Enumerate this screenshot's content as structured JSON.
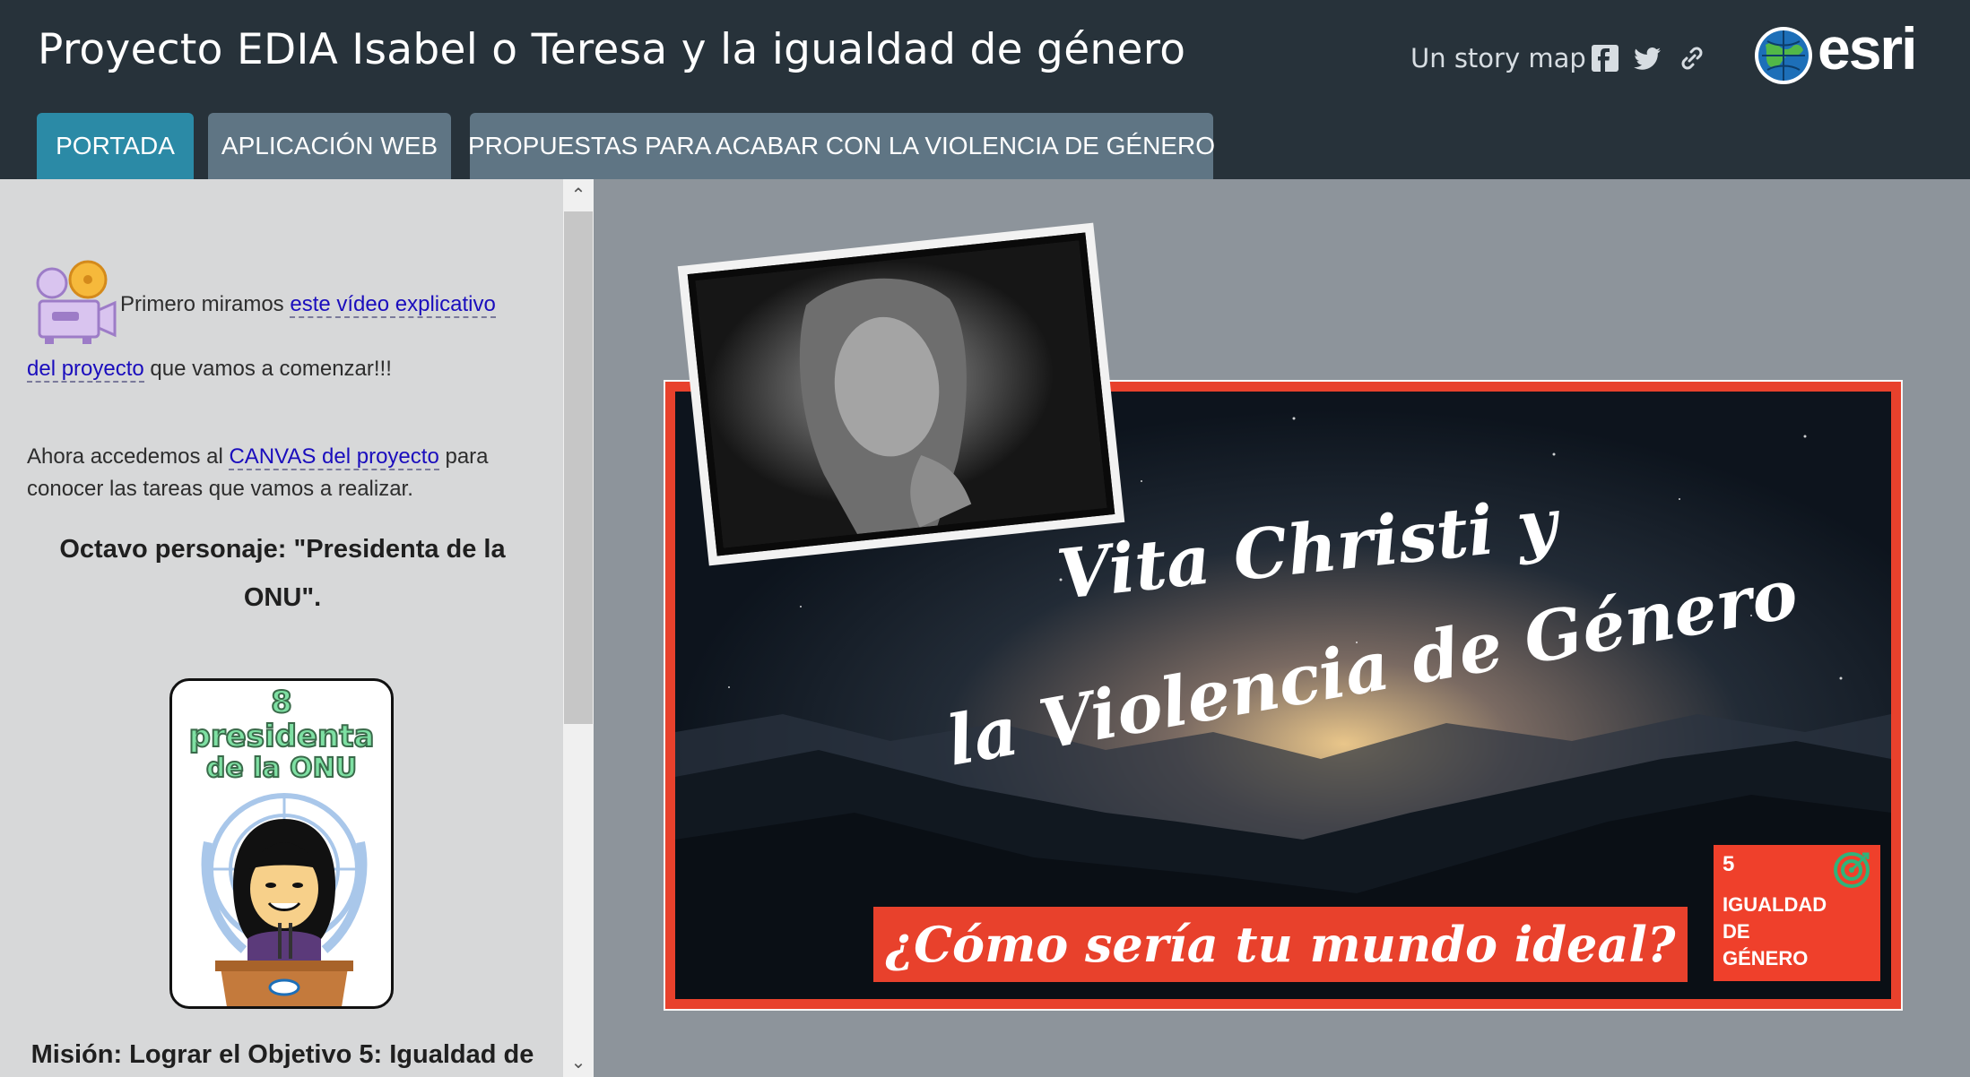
{
  "header": {
    "title": "Proyecto EDIA Isabel o Teresa y la igualdad de género",
    "storymap_label": "Un story map",
    "share": [
      "facebook-icon",
      "twitter-icon",
      "link-icon"
    ],
    "brand": "esri"
  },
  "tabs": [
    {
      "label": "PORTADA",
      "active": true
    },
    {
      "label": "APLICACIÓN WEB",
      "active": false
    },
    {
      "label": "PROPUESTAS PARA ACABAR CON LA VIOLENCIA DE GÉNERO",
      "active": false
    }
  ],
  "side": {
    "p1_pre": "Primero miramos ",
    "p1_link_a": "este vídeo explicativo",
    "p1_link_b": "del proyecto",
    "p1_post": " que vamos a comenzar!!!",
    "p2_pre": "Ahora accedemos al ",
    "p2_link": "CANVAS del proyecto",
    "p2_post_a": " para",
    "p2_post_b": "conocer las tareas que vamos a realizar.",
    "heading_a": "Octavo personaje: \"Presidenta de la",
    "heading_b": "ONU\".",
    "card": {
      "num": "8",
      "line1": "presidenta",
      "line2": "de la ONU"
    },
    "mission": "Misión: Lograr el Objetivo 5: Igualdad de"
  },
  "poster": {
    "title_line1": "Vita Christi y",
    "title_line2": "la Violencia de Género",
    "banner": "¿Cómo sería tu mundo ideal?",
    "sdg": {
      "num": "5",
      "l1": "IGUALDAD",
      "l2": "DE",
      "l3": "GÉNERO"
    }
  },
  "colors": {
    "header_bg": "#27323a",
    "tab_active": "#2b8aa6",
    "tab_inactive": "#5f7584",
    "link": "#1a0dbd",
    "poster_red": "#e8412c"
  }
}
